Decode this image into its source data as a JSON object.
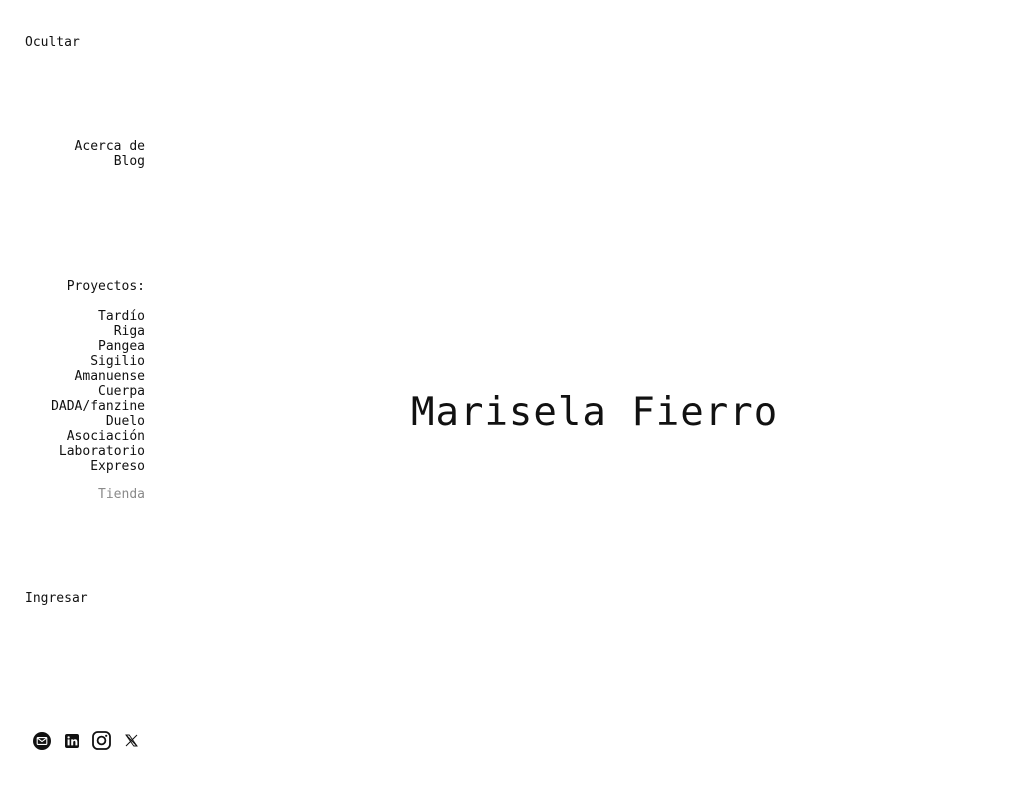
{
  "sidebar": {
    "hide_label": "Ocultar",
    "top_links": [
      "Acerca de",
      "Blog"
    ],
    "projects_heading": "Proyectos:",
    "projects": [
      "Tardío",
      "Riga",
      "Pangea",
      "Sigilio",
      "Amanuense",
      "Cuerpa",
      "DADA/fanzine",
      "Duelo",
      "Asociación",
      "Laboratorio",
      "Expreso"
    ],
    "shop_label": "Tienda",
    "login_label": "Ingresar"
  },
  "main": {
    "title": "Marisela Fierro"
  },
  "social": {
    "icons": [
      "email-icon",
      "linkedin-icon",
      "instagram-icon",
      "x-icon"
    ]
  },
  "colors": {
    "text": "#111111",
    "muted": "#8a8a8a",
    "background": "#ffffff"
  }
}
